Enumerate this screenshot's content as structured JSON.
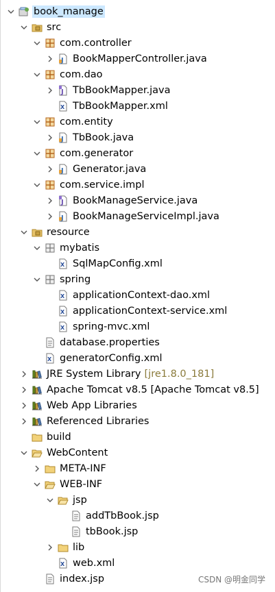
{
  "tree": [
    {
      "label": "book_manage",
      "icon": "project-icon",
      "expand": "open",
      "depth": 0,
      "selected": true
    },
    {
      "label": "src",
      "icon": "source-folder-icon",
      "expand": "open",
      "depth": 1
    },
    {
      "label": "com.controller",
      "icon": "package-icon",
      "expand": "open",
      "depth": 2
    },
    {
      "label": "BookMapperController.java",
      "icon": "java-file-icon",
      "expand": "closed",
      "depth": 3
    },
    {
      "label": "com.dao",
      "icon": "package-icon",
      "expand": "open",
      "depth": 2
    },
    {
      "label": "TbBookMapper.java",
      "icon": "java-interface-icon",
      "expand": "closed",
      "depth": 3
    },
    {
      "label": "TbBookMapper.xml",
      "icon": "xml-file-icon",
      "expand": "none",
      "depth": 3
    },
    {
      "label": "com.entity",
      "icon": "package-icon",
      "expand": "open",
      "depth": 2
    },
    {
      "label": "TbBook.java",
      "icon": "java-file-icon",
      "expand": "closed",
      "depth": 3
    },
    {
      "label": "com.generator",
      "icon": "package-icon",
      "expand": "open",
      "depth": 2
    },
    {
      "label": "Generator.java",
      "icon": "java-file-icon",
      "expand": "closed",
      "depth": 3
    },
    {
      "label": "com.service.impl",
      "icon": "package-icon",
      "expand": "open",
      "depth": 2
    },
    {
      "label": "BookManageService.java",
      "icon": "java-interface-icon",
      "expand": "closed",
      "depth": 3
    },
    {
      "label": "BookManageServiceImpl.java",
      "icon": "java-file-icon",
      "expand": "closed",
      "depth": 3
    },
    {
      "label": "resource",
      "icon": "source-folder-icon",
      "expand": "open",
      "depth": 1
    },
    {
      "label": "mybatis",
      "icon": "package-folder-icon",
      "expand": "open",
      "depth": 2
    },
    {
      "label": "SqlMapConfig.xml",
      "icon": "xml-file-icon",
      "expand": "none",
      "depth": 3
    },
    {
      "label": "spring",
      "icon": "package-folder-icon",
      "expand": "open",
      "depth": 2
    },
    {
      "label": "applicationContext-dao.xml",
      "icon": "xml-file-icon",
      "expand": "none",
      "depth": 3
    },
    {
      "label": "applicationContext-service.xml",
      "icon": "xml-file-icon",
      "expand": "none",
      "depth": 3
    },
    {
      "label": "spring-mvc.xml",
      "icon": "xml-file-icon",
      "expand": "none",
      "depth": 3
    },
    {
      "label": "database.properties",
      "icon": "properties-file-icon",
      "expand": "none",
      "depth": 2
    },
    {
      "label": "generatorConfig.xml",
      "icon": "xml-file-icon",
      "expand": "none",
      "depth": 2
    },
    {
      "label": "JRE System Library",
      "decoration": "[jre1.8.0_181]",
      "icon": "library-icon",
      "expand": "closed",
      "depth": 1
    },
    {
      "label": "Apache Tomcat v8.5 [Apache Tomcat v8.5]",
      "icon": "library-icon",
      "expand": "closed",
      "depth": 1
    },
    {
      "label": "Web App Libraries",
      "icon": "library-icon",
      "expand": "closed",
      "depth": 1
    },
    {
      "label": "Referenced Libraries",
      "icon": "library-icon",
      "expand": "closed",
      "depth": 1
    },
    {
      "label": "build",
      "icon": "folder-icon",
      "expand": "none",
      "depth": 1
    },
    {
      "label": "WebContent",
      "icon": "folder-open-icon",
      "expand": "open",
      "depth": 1
    },
    {
      "label": "META-INF",
      "icon": "folder-icon",
      "expand": "closed",
      "depth": 2
    },
    {
      "label": "WEB-INF",
      "icon": "folder-open-icon",
      "expand": "open",
      "depth": 2
    },
    {
      "label": "jsp",
      "icon": "folder-open-icon",
      "expand": "open",
      "depth": 3
    },
    {
      "label": "addTbBook.jsp",
      "icon": "jsp-file-icon",
      "expand": "none",
      "depth": 4
    },
    {
      "label": "tbBook.jsp",
      "icon": "jsp-file-icon",
      "expand": "none",
      "depth": 4
    },
    {
      "label": "lib",
      "icon": "folder-icon",
      "expand": "closed",
      "depth": 3
    },
    {
      "label": "web.xml",
      "icon": "xml-file-icon",
      "expand": "none",
      "depth": 3
    },
    {
      "label": "index.jsp",
      "icon": "jsp-file-icon",
      "expand": "none",
      "depth": 2
    }
  ],
  "watermark": "CSDN @明金同学",
  "colors": {
    "selection": "#cce8ff",
    "package": "#b5651d",
    "folder": "#e8c46a",
    "java": "#3a6fb0",
    "decoration": "#8a7a3a"
  }
}
